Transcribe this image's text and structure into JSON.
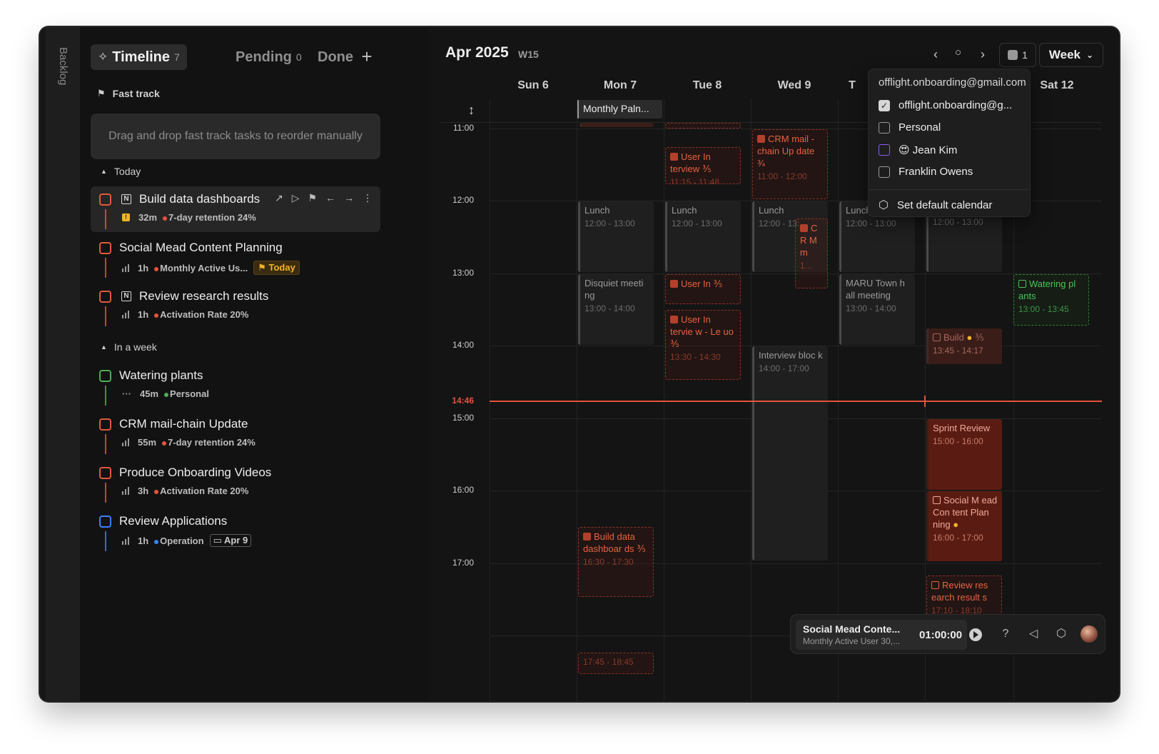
{
  "sidebar": {
    "backlog_label": "Backlog"
  },
  "tabs": [
    {
      "label": "Timeline",
      "count": "7"
    },
    {
      "label": "Pending",
      "count": "0"
    },
    {
      "label": "Done",
      "count": ""
    }
  ],
  "fast_track": {
    "label": "Fast track",
    "placeholder": "Drag and drop fast track tasks to reorder manually"
  },
  "sections": {
    "today": "Today",
    "week": "In a week"
  },
  "tasks": [
    {
      "title": "Build data dashboards",
      "duration": "32m",
      "tag": "7-day retention 24%",
      "tag_color": "#e5533d"
    },
    {
      "title": "Social Mead Content Planning",
      "duration": "1h",
      "tag": "Monthly Active Us...",
      "badge": "Today",
      "tag_color": "#e5533d"
    },
    {
      "title": "Review research results",
      "duration": "1h",
      "tag": "Activation Rate 20%",
      "tag_color": "#e5533d"
    },
    {
      "title": "Watering plants",
      "duration": "45m",
      "tag": "Personal",
      "tag_color": "#4caf50"
    },
    {
      "title": "CRM mail-chain Update",
      "duration": "55m",
      "tag": "7-day retention 24%",
      "tag_color": "#e5533d"
    },
    {
      "title": "Produce Onboarding Videos",
      "duration": "3h",
      "tag": "Activation Rate 20%",
      "tag_color": "#e5533d"
    },
    {
      "title": "Review Applications",
      "duration": "1h",
      "tag": "Operation",
      "badge": "Apr 9",
      "tag_color": "#3b82f6"
    }
  ],
  "calendar": {
    "title": "Apr 2025",
    "week": "W15",
    "cal_count": "1",
    "view": "Week",
    "days": [
      "Sun 6",
      "Mon 7",
      "Tue 8",
      "Wed 9",
      "T",
      "Sat 12"
    ],
    "hours": [
      "11:00",
      "12:00",
      "13:00",
      "14:00",
      "15:00",
      "16:00",
      "17:00"
    ],
    "now": "14:46",
    "allday": "Monthly Paln..."
  },
  "events": {
    "mon_lunch": {
      "title": "Lunch",
      "time": "12:00 - 13:00"
    },
    "mon_disquiet": {
      "title": "Disquiet meeti ng",
      "time": "13:00 - 14:00"
    },
    "mon_build": {
      "title": "Build data dashboar ds",
      "time": "16:30 - 17:30",
      "frac": "⅗"
    },
    "mon_bottom": {
      "time": "17:45 - 18:45"
    },
    "tue_ui1": {
      "title": "User In terview",
      "time": "11:15 - 11:48",
      "frac": "⅗"
    },
    "tue_lunch": {
      "title": "Lunch",
      "time": "12:00 - 13:00"
    },
    "tue_ui2": {
      "title": "User In",
      "frac": "⅗"
    },
    "tue_ui3": {
      "title": "User In tervie w - Le uo",
      "time": "13:30 - 14:30",
      "frac": "⅗"
    },
    "wed_crm": {
      "title": "CRM mail -chain Up date",
      "time": "11:00 - 12:00",
      "frac": "¾"
    },
    "wed_lunch": {
      "title": "Lunch",
      "time": "12:00 - 13:"
    },
    "wed_crm2": {
      "title": "C R M m",
      "time": "1..."
    },
    "wed_interview": {
      "title": "Interview bloc k",
      "time": "14:00 - 17:00"
    },
    "thu_lunch": {
      "title": "Lunch",
      "time": "12:00 - 13:00"
    },
    "thu_maru": {
      "title": "MARU Town h all meeting",
      "time": "13:00 - 14:00"
    },
    "fri_lunch": {
      "time": "12:00 - 13:00"
    },
    "fri_build": {
      "title": "Build",
      "time": "13:45 - 14:17",
      "frac": "⅗"
    },
    "fri_sprint": {
      "title": "Sprint Review",
      "time": "15:00 - 16:00"
    },
    "fri_social": {
      "title": "Social M ead Con tent Plan ning",
      "time": "16:00 - 17:00"
    },
    "fri_review": {
      "title": "Review res earch result s",
      "time": "17:10 - 18:10"
    },
    "sat_water": {
      "title": "Watering pl ants",
      "time": "13:00 - 13:45"
    }
  },
  "dropdown": {
    "email": "offlight.onboarding@gmail.com",
    "items": [
      "offlight.onboarding@g...",
      "Personal",
      "😍 Jean Kim",
      "Franklin Owens"
    ],
    "default_label": "Set default calendar"
  },
  "player": {
    "title": "Social Mead Conte...",
    "subtitle": "Monthly Active User 30,...",
    "time": "01:00:00"
  }
}
